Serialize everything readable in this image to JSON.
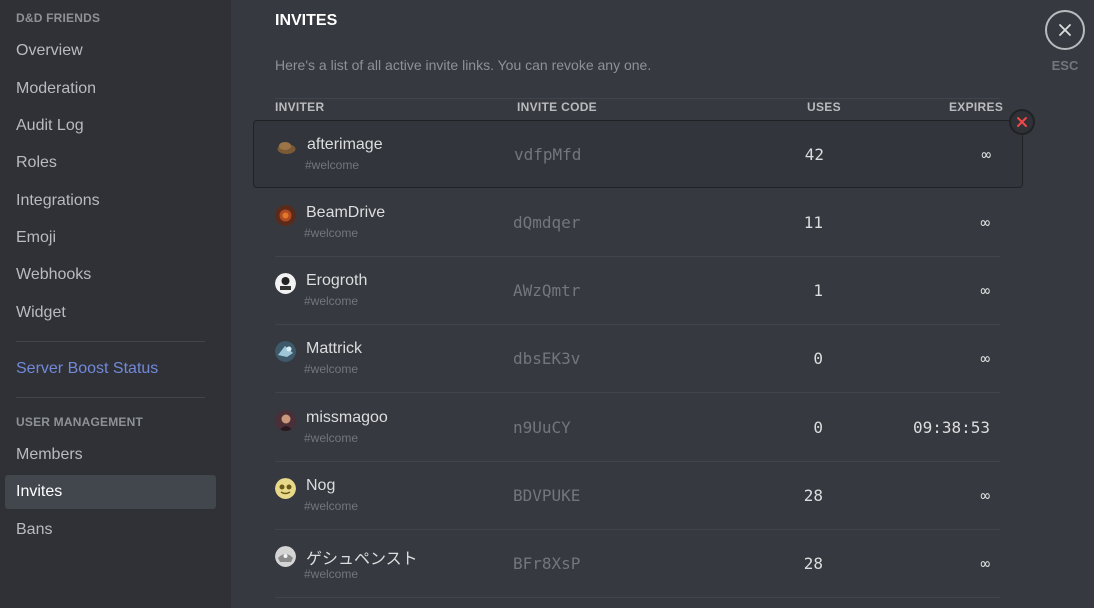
{
  "sidebar": {
    "server_header": "D&D FRIENDS",
    "items": [
      {
        "label": "Overview"
      },
      {
        "label": "Moderation"
      },
      {
        "label": "Audit Log"
      },
      {
        "label": "Roles"
      },
      {
        "label": "Integrations"
      },
      {
        "label": "Emoji"
      },
      {
        "label": "Webhooks"
      },
      {
        "label": "Widget"
      }
    ],
    "boost_label": "Server Boost Status",
    "user_mgmt_header": "USER MANAGEMENT",
    "user_items": [
      {
        "label": "Members"
      },
      {
        "label": "Invites",
        "active": true
      },
      {
        "label": "Bans"
      }
    ]
  },
  "main": {
    "title": "INVITES",
    "description": "Here's a list of all active invite links. You can revoke any one.",
    "columns": {
      "inviter": "INVITER",
      "code": "INVITE CODE",
      "uses": "USES",
      "expires": "EXPIRES"
    },
    "invites": [
      {
        "inviter": "afterimage",
        "channel": "#welcome",
        "code": "vdfpMfd",
        "uses": "42",
        "expires": "∞"
      },
      {
        "inviter": "BeamDrive",
        "channel": "#welcome",
        "code": "dQmdqer",
        "uses": "11",
        "expires": "∞"
      },
      {
        "inviter": "Erogroth",
        "channel": "#welcome",
        "code": "AWzQmtr",
        "uses": "1",
        "expires": "∞"
      },
      {
        "inviter": "Mattrick",
        "channel": "#welcome",
        "code": "dbsEK3v",
        "uses": "0",
        "expires": "∞"
      },
      {
        "inviter": "missmagoo",
        "channel": "#welcome",
        "code": "n9UuCY",
        "uses": "0",
        "expires": "09:38:53"
      },
      {
        "inviter": "Nog",
        "channel": "#welcome",
        "code": "BDVPUKE",
        "uses": "28",
        "expires": "∞"
      },
      {
        "inviter": "ゲシュペンスト",
        "channel": "#welcome",
        "code": "BFr8XsP",
        "uses": "28",
        "expires": "∞"
      }
    ]
  },
  "close": {
    "esc_label": "ESC"
  },
  "colors": {
    "accent": "#7289da",
    "revoke_red": "#f04747",
    "background": "#36393f",
    "sidebar": "#2f3136"
  }
}
